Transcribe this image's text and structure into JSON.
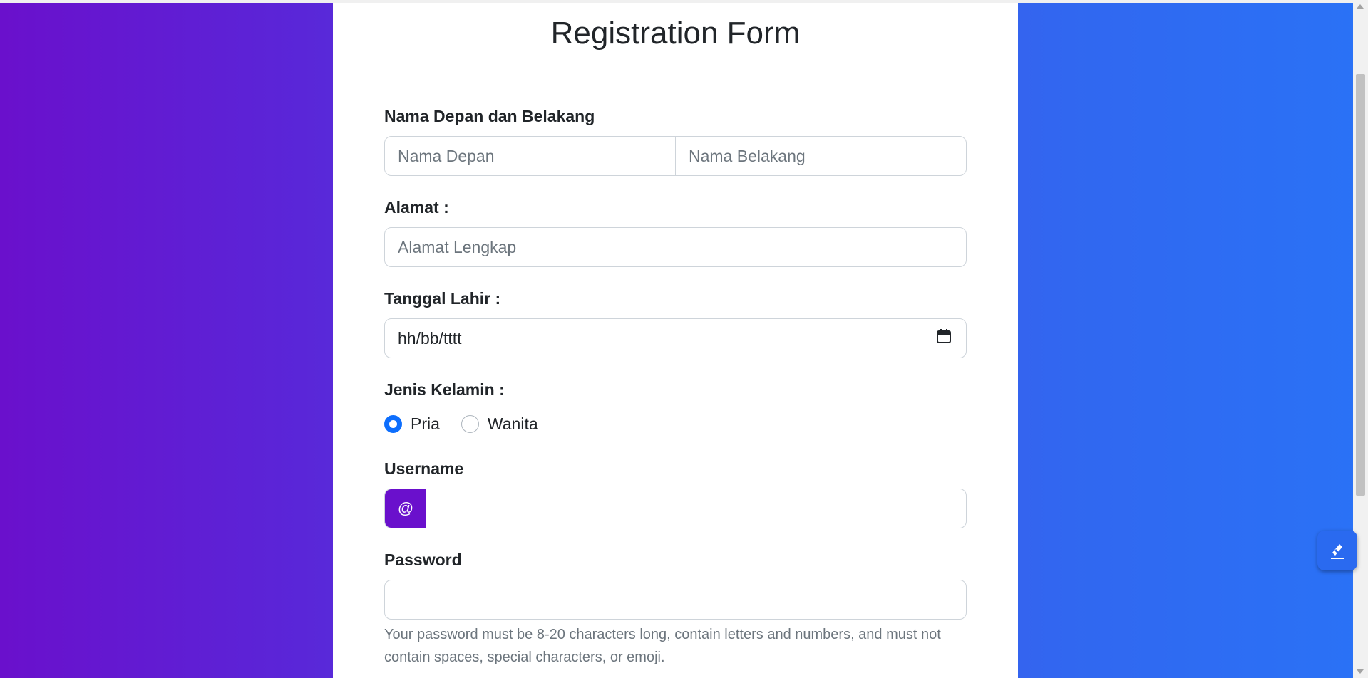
{
  "title": "Registration Form",
  "fields": {
    "name_label": "Nama Depan dan Belakang",
    "first_name_placeholder": "Nama Depan",
    "last_name_placeholder": "Nama Belakang",
    "address_label": "Alamat :",
    "address_placeholder": "Alamat Lengkap",
    "birthdate_label": "Tanggal Lahir :",
    "birthdate_value": "hh/bb/tttt",
    "gender_label": "Jenis Kelamin :",
    "gender_options": [
      "Pria",
      "Wanita"
    ],
    "gender_selected": "Pria",
    "username_label": "Username",
    "username_prefix": "@",
    "password_label": "Password",
    "password_help": "Your password must be 8-20 characters long, contain letters and numbers, and must not contain spaces, special characters, or emoji."
  },
  "icons": {
    "calendar": "calendar-icon",
    "floating_button": "pencil-bolt-icon"
  },
  "colors": {
    "gradient_start": "#6a10cc",
    "gradient_end": "#2a72f6",
    "radio_selected": "#0d6efd",
    "addon_bg": "#6a10cc"
  }
}
